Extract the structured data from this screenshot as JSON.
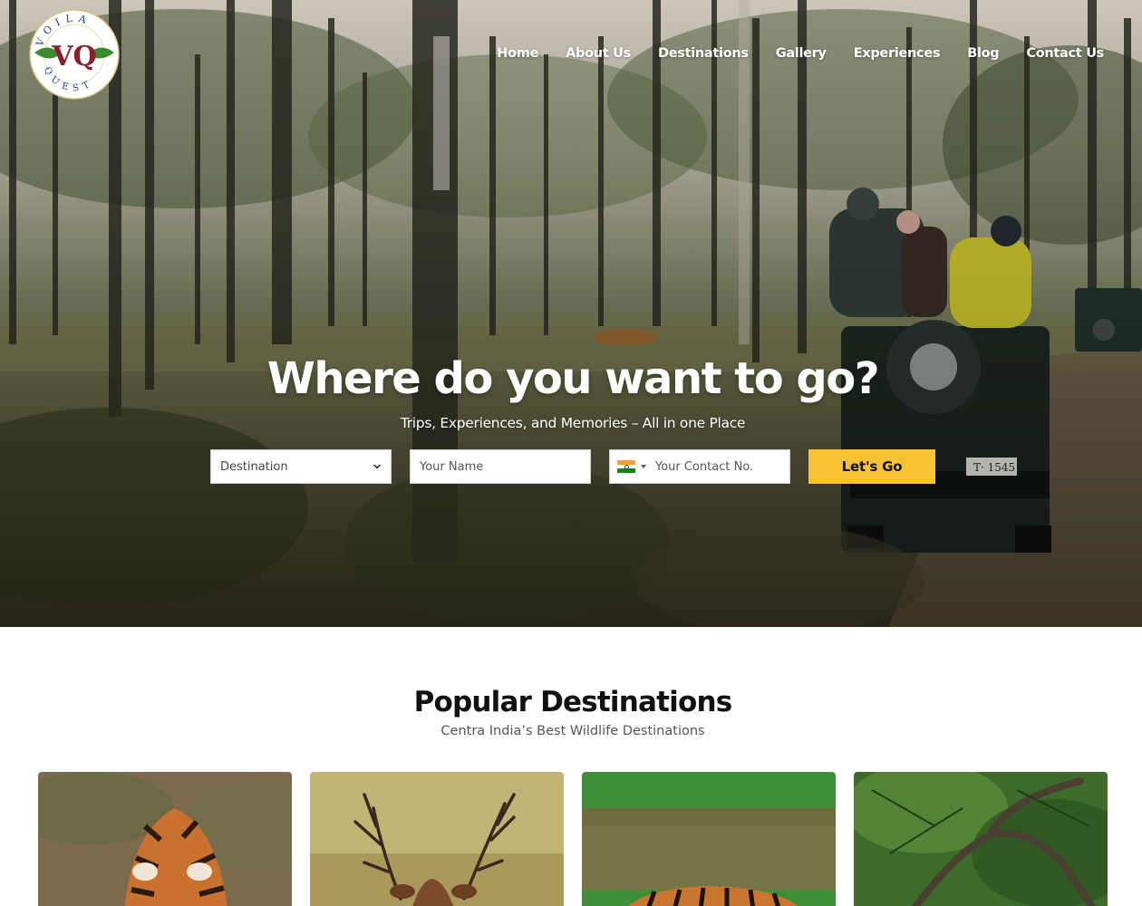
{
  "brand": {
    "logo_letters": "VQ",
    "logo_ring_text": "VOILA QUEST"
  },
  "nav": {
    "items": [
      {
        "label": "Home"
      },
      {
        "label": "About Us"
      },
      {
        "label": "Destinations"
      },
      {
        "label": "Gallery"
      },
      {
        "label": "Experiences"
      },
      {
        "label": "Blog"
      },
      {
        "label": "Contact Us"
      }
    ]
  },
  "hero": {
    "title": "Where do you want to go?",
    "subtitle": "Trips, Experiences, and Memories – All in one Place",
    "vehicle_plate": "T· 1545"
  },
  "form": {
    "destination_value": "Destination",
    "name_placeholder": "Your Name",
    "phone_placeholder": "Your Contact No.",
    "phone_country_icon": "india-flag-icon",
    "submit_label": "Let's Go",
    "accent_color": "#f6c232"
  },
  "destinations": {
    "title": "Popular Destinations",
    "subtitle": "Centra India’s Best Wildlife Destinations",
    "cards": [
      {
        "image": "tiger-image"
      },
      {
        "image": "deer-image"
      },
      {
        "image": "tiger-in-water-image"
      },
      {
        "image": "forest-branches-image"
      }
    ]
  }
}
